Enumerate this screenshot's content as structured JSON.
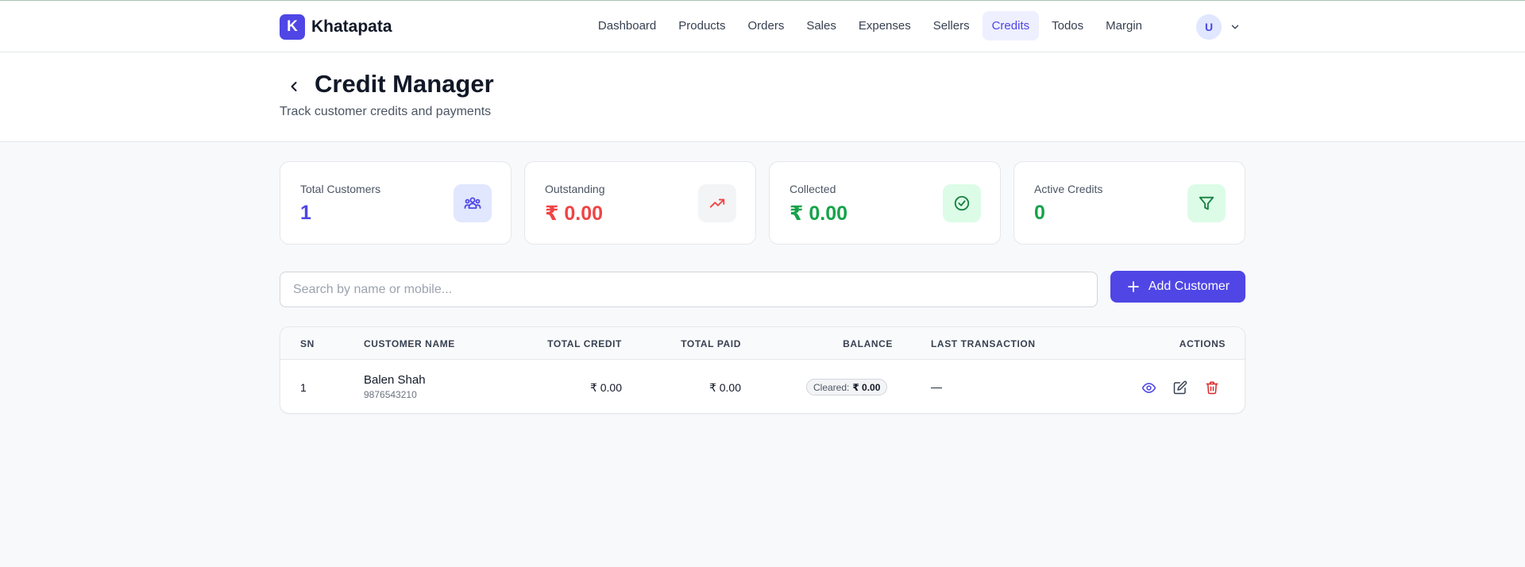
{
  "brand": {
    "logo_letter": "K",
    "name": "Khatapata"
  },
  "nav": {
    "items": [
      "Dashboard",
      "Products",
      "Orders",
      "Sales",
      "Expenses",
      "Sellers",
      "Credits",
      "Todos",
      "Margin"
    ],
    "active": "Credits"
  },
  "user": {
    "initial": "U"
  },
  "header": {
    "title": "Credit Manager",
    "subtitle": "Track customer credits and payments"
  },
  "stats": [
    {
      "label": "Total Customers",
      "value": "1",
      "color": "#4f46e5",
      "icon": "users-icon",
      "icon_bg": "#e0e7ff"
    },
    {
      "label": "Outstanding",
      "value": "₹ 0.00",
      "color": "#ef4444",
      "icon": "trending-up-icon",
      "icon_bg": "#f3f4f6"
    },
    {
      "label": "Collected",
      "value": "₹ 0.00",
      "color": "#16a34a",
      "icon": "check-circle-icon",
      "icon_bg": "#dcfce7"
    },
    {
      "label": "Active Credits",
      "value": "0",
      "color": "#16a34a",
      "icon": "filter-icon",
      "icon_bg": "#dcfce7"
    }
  ],
  "search": {
    "placeholder": "Search by name or mobile...",
    "value": ""
  },
  "add_button": {
    "label": "Add Customer"
  },
  "table": {
    "headers": [
      "SN",
      "CUSTOMER NAME",
      "TOTAL CREDIT",
      "TOTAL PAID",
      "BALANCE",
      "LAST TRANSACTION",
      "ACTIONS"
    ],
    "rows": [
      {
        "sn": "1",
        "name": "Balen Shah",
        "mobile": "9876543210",
        "total_credit": "₹ 0.00",
        "total_paid": "₹ 0.00",
        "balance_status": "Cleared:",
        "balance_amount": "₹ 0.00",
        "last_transaction": "—"
      }
    ]
  },
  "colors": {
    "accent": "#4f46e5",
    "danger": "#dc2626",
    "success": "#16a34a"
  }
}
